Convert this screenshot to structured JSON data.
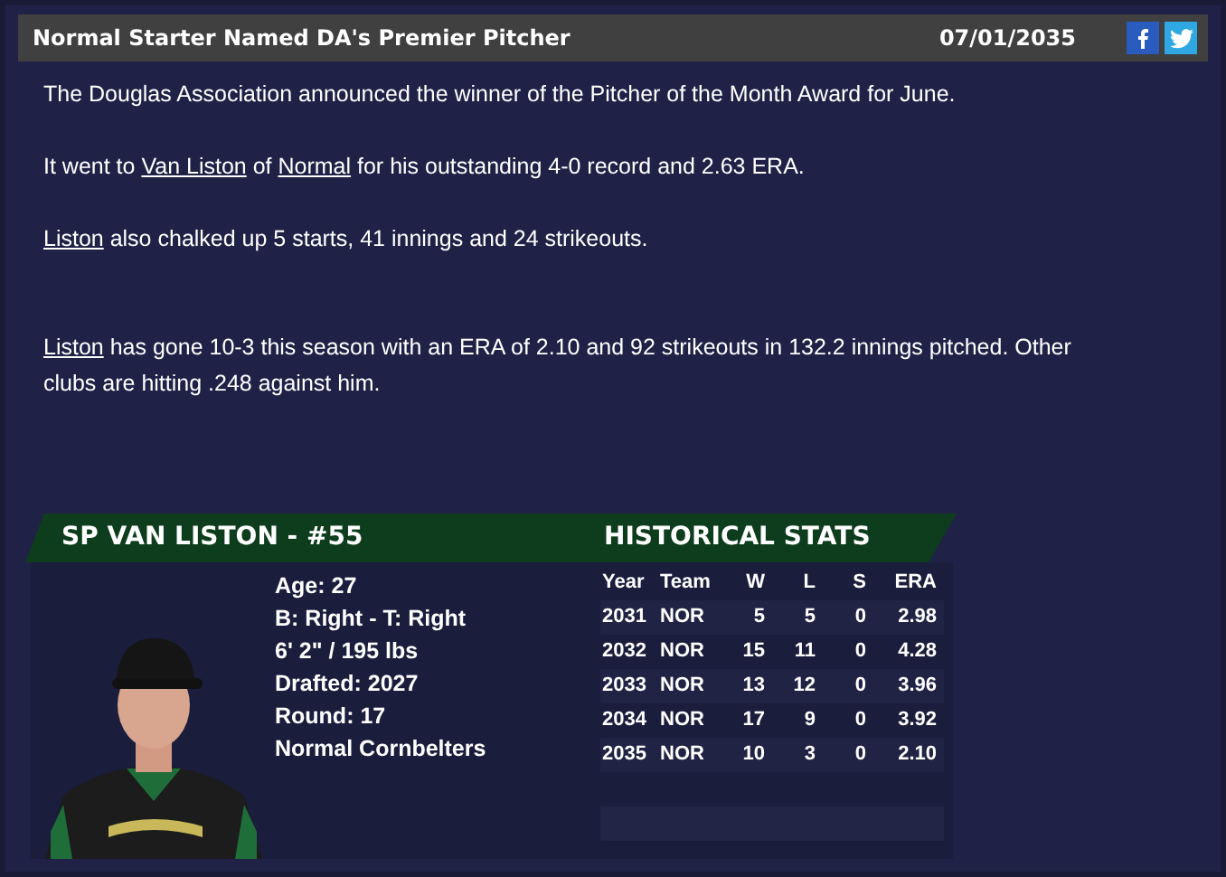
{
  "header": {
    "title": "Normal Starter Named DA's Premier Pitcher",
    "date": "07/01/2035"
  },
  "paragraphs": [
    [
      {
        "text": "The Douglas Association announced the winner of the Pitcher of the Month Award for June.",
        "link": false
      }
    ],
    [
      {
        "text": "It went to ",
        "link": false
      },
      {
        "text": "Van Liston",
        "link": true
      },
      {
        "text": " of ",
        "link": false
      },
      {
        "text": "Normal",
        "link": true
      },
      {
        "text": " for his outstanding 4-0 record and 2.63 ERA.",
        "link": false
      }
    ],
    [
      {
        "text": "Liston",
        "link": true
      },
      {
        "text": " also chalked up 5 starts, 41 innings and 24 strikeouts.",
        "link": false
      }
    ],
    [
      {
        "text": "Liston",
        "link": true
      },
      {
        "text": " has gone 10-3 this season with an ERA of 2.10 and 92 strikeouts in 132.2 innings pitched. Other clubs are hitting .248 against him.",
        "link": false
      }
    ]
  ],
  "player": {
    "heading": "SP VAN LISTON - #55",
    "bio": [
      "Age: 27",
      "B: Right - T: Right",
      "6' 2\" / 195 lbs",
      "Drafted: 2027",
      "Round: 17",
      "Normal Cornbelters"
    ]
  },
  "stats": {
    "heading": "HISTORICAL STATS",
    "columns": [
      "Year",
      "Team",
      "W",
      "L",
      "S",
      "ERA"
    ],
    "rows": [
      [
        "2031",
        "NOR",
        "5",
        "5",
        "0",
        "2.98"
      ],
      [
        "2032",
        "NOR",
        "15",
        "11",
        "0",
        "4.28"
      ],
      [
        "2033",
        "NOR",
        "13",
        "12",
        "0",
        "3.96"
      ],
      [
        "2034",
        "NOR",
        "17",
        "9",
        "0",
        "3.92"
      ],
      [
        "2035",
        "NOR",
        "10",
        "3",
        "0",
        "2.10"
      ]
    ]
  }
}
